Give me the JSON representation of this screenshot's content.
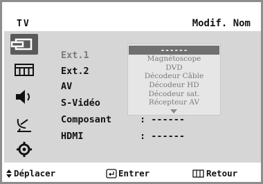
{
  "header": {
    "app_label": "TV",
    "title": "Modif. Nom"
  },
  "sidebar": {
    "items": [
      {
        "icon": "input-icon",
        "active": true
      },
      {
        "icon": "picture-icon",
        "active": false
      },
      {
        "icon": "sound-icon",
        "active": false
      },
      {
        "icon": "channel-icon",
        "active": false
      },
      {
        "icon": "setup-icon",
        "active": false
      }
    ]
  },
  "sources": [
    {
      "label": "Ext.1",
      "value": ""
    },
    {
      "label": "Ext.2",
      "value": ""
    },
    {
      "label": "AV",
      "value": ""
    },
    {
      "label": "S-Vidéo",
      "value": ""
    },
    {
      "label": "Composant",
      "value": ": ------"
    },
    {
      "label": "HDMI",
      "value": ": ------"
    }
  ],
  "dropdown": {
    "selected": "------",
    "options": [
      "Magnétoscope",
      "DVD",
      "Décodeur Câble",
      "Décodeur HD",
      "Décodeur sat.",
      "Récepteur AV"
    ]
  },
  "footer": {
    "move": "Déplacer",
    "enter": "Entrer",
    "back": "Retour"
  }
}
